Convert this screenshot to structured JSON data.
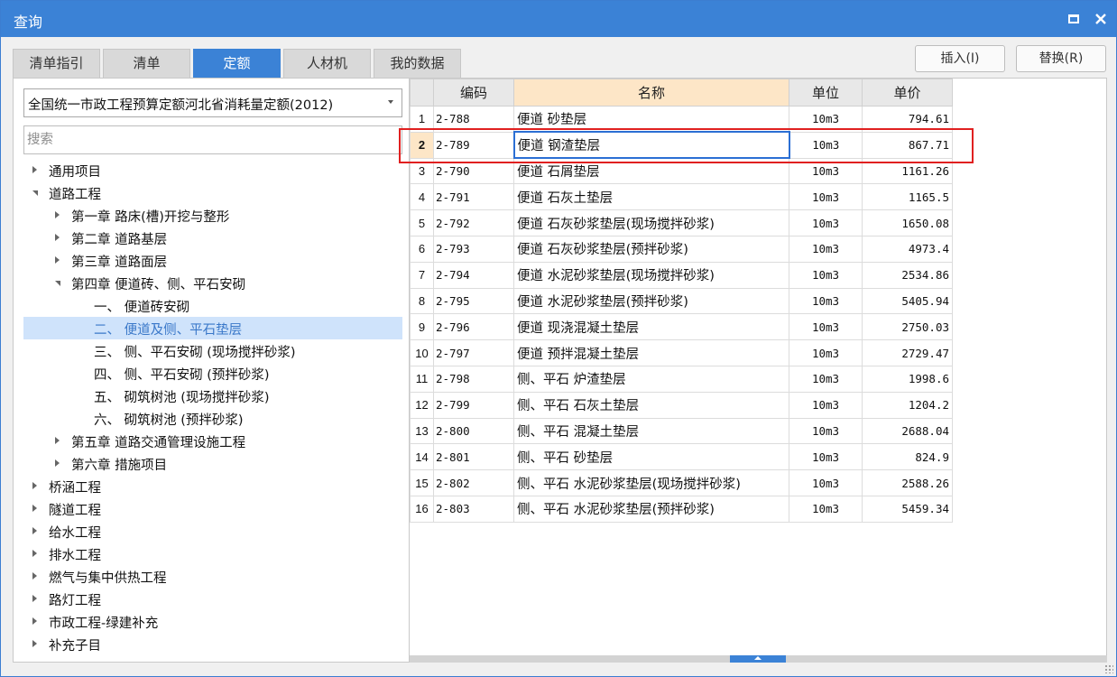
{
  "window": {
    "title": "查询"
  },
  "tabs": [
    {
      "label": "清单指引",
      "active": false
    },
    {
      "label": "清单",
      "active": false
    },
    {
      "label": "定额",
      "active": true
    },
    {
      "label": "人材机",
      "active": false
    },
    {
      "label": "我的数据",
      "active": false
    }
  ],
  "buttons": {
    "insert": "插入(I)",
    "replace": "替换(R)"
  },
  "library": {
    "selected": "全国统一市政工程预算定额河北省消耗量定额(2012)"
  },
  "search": {
    "placeholder": "搜索",
    "value": ""
  },
  "tree": [
    {
      "label": "通用项目",
      "level": 0,
      "state": "collapsed",
      "selected": false
    },
    {
      "label": "道路工程",
      "level": 0,
      "state": "expanded",
      "selected": false
    },
    {
      "label": "第一章 路床(槽)开挖与整形",
      "level": 1,
      "state": "collapsed",
      "selected": false
    },
    {
      "label": "第二章 道路基层",
      "level": 1,
      "state": "collapsed",
      "selected": false
    },
    {
      "label": "第三章 道路面层",
      "level": 1,
      "state": "collapsed",
      "selected": false
    },
    {
      "label": "第四章 便道砖、侧、平石安砌",
      "level": 1,
      "state": "expanded",
      "selected": false
    },
    {
      "label": "一、 便道砖安砌",
      "level": 2,
      "state": "leaf",
      "selected": false
    },
    {
      "label": "二、 便道及侧、平石垫层",
      "level": 2,
      "state": "leaf",
      "selected": true
    },
    {
      "label": "三、 侧、平石安砌 (现场搅拌砂浆)",
      "level": 2,
      "state": "leaf",
      "selected": false
    },
    {
      "label": "四、 侧、平石安砌 (预拌砂浆)",
      "level": 2,
      "state": "leaf",
      "selected": false
    },
    {
      "label": "五、 砌筑树池 (现场搅拌砂浆)",
      "level": 2,
      "state": "leaf",
      "selected": false
    },
    {
      "label": "六、 砌筑树池 (预拌砂浆)",
      "level": 2,
      "state": "leaf",
      "selected": false
    },
    {
      "label": "第五章 道路交通管理设施工程",
      "level": 1,
      "state": "collapsed",
      "selected": false
    },
    {
      "label": "第六章 措施项目",
      "level": 1,
      "state": "collapsed",
      "selected": false
    },
    {
      "label": "桥涵工程",
      "level": 0,
      "state": "collapsed",
      "selected": false
    },
    {
      "label": "隧道工程",
      "level": 0,
      "state": "collapsed",
      "selected": false
    },
    {
      "label": "给水工程",
      "level": 0,
      "state": "collapsed",
      "selected": false
    },
    {
      "label": "排水工程",
      "level": 0,
      "state": "collapsed",
      "selected": false
    },
    {
      "label": "燃气与集中供热工程",
      "level": 0,
      "state": "collapsed",
      "selected": false
    },
    {
      "label": "路灯工程",
      "level": 0,
      "state": "collapsed",
      "selected": false
    },
    {
      "label": "市政工程-绿建补充",
      "level": 0,
      "state": "collapsed",
      "selected": false
    },
    {
      "label": "补充子目",
      "level": 0,
      "state": "collapsed",
      "selected": false
    }
  ],
  "table": {
    "headers": {
      "code": "编码",
      "name": "名称",
      "unit": "单位",
      "price": "单价"
    },
    "current_row": 2,
    "rows": [
      {
        "num": "1",
        "code": "2-788",
        "name": "便道 砂垫层",
        "unit": "10m3",
        "price": "794.61"
      },
      {
        "num": "2",
        "code": "2-789",
        "name": "便道 钢渣垫层",
        "unit": "10m3",
        "price": "867.71"
      },
      {
        "num": "3",
        "code": "2-790",
        "name": "便道 石屑垫层",
        "unit": "10m3",
        "price": "1161.26"
      },
      {
        "num": "4",
        "code": "2-791",
        "name": "便道 石灰土垫层",
        "unit": "10m3",
        "price": "1165.5"
      },
      {
        "num": "5",
        "code": "2-792",
        "name": "便道 石灰砂浆垫层(现场搅拌砂浆)",
        "unit": "10m3",
        "price": "1650.08"
      },
      {
        "num": "6",
        "code": "2-793",
        "name": "便道 石灰砂浆垫层(预拌砂浆)",
        "unit": "10m3",
        "price": "4973.4"
      },
      {
        "num": "7",
        "code": "2-794",
        "name": "便道 水泥砂浆垫层(现场搅拌砂浆)",
        "unit": "10m3",
        "price": "2534.86"
      },
      {
        "num": "8",
        "code": "2-795",
        "name": "便道 水泥砂浆垫层(预拌砂浆)",
        "unit": "10m3",
        "price": "5405.94"
      },
      {
        "num": "9",
        "code": "2-796",
        "name": "便道 现浇混凝土垫层",
        "unit": "10m3",
        "price": "2750.03"
      },
      {
        "num": "10",
        "code": "2-797",
        "name": "便道 预拌混凝土垫层",
        "unit": "10m3",
        "price": "2729.47"
      },
      {
        "num": "11",
        "code": "2-798",
        "name": "侧、平石 炉渣垫层",
        "unit": "10m3",
        "price": "1998.6"
      },
      {
        "num": "12",
        "code": "2-799",
        "name": "侧、平石 石灰土垫层",
        "unit": "10m3",
        "price": "1204.2"
      },
      {
        "num": "13",
        "code": "2-800",
        "name": "侧、平石 混凝土垫层",
        "unit": "10m3",
        "price": "2688.04"
      },
      {
        "num": "14",
        "code": "2-801",
        "name": "侧、平石 砂垫层",
        "unit": "10m3",
        "price": "824.9"
      },
      {
        "num": "15",
        "code": "2-802",
        "name": "侧、平石 水泥砂浆垫层(现场搅拌砂浆)",
        "unit": "10m3",
        "price": "2588.26"
      },
      {
        "num": "16",
        "code": "2-803",
        "name": "侧、平石 水泥砂浆垫层(预拌砂浆)",
        "unit": "10m3",
        "price": "5459.34"
      }
    ]
  },
  "colors": {
    "accent": "#3b82d6",
    "highlight_border": "#e02020",
    "selected_tree": "#cfe3fb",
    "header_name": "#fde6c7"
  },
  "icons": {
    "maximize": "maximize-icon",
    "close": "close-icon",
    "dropdown": "chevron-down-icon",
    "expand": "triangle-right-icon",
    "collapse": "triangle-down-icon"
  }
}
